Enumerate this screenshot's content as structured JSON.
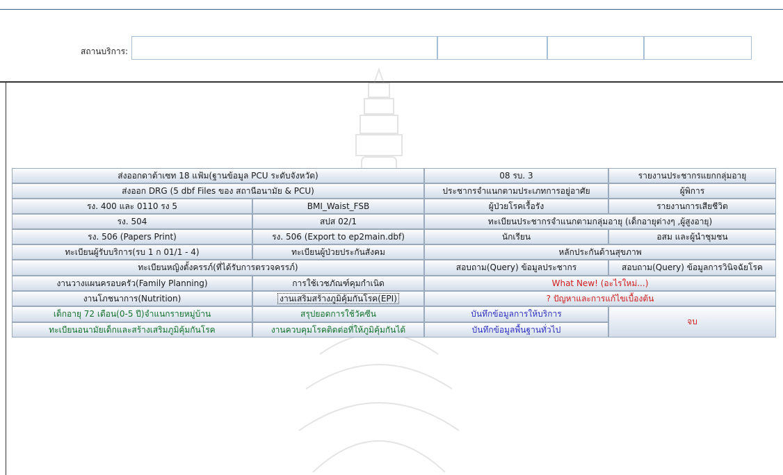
{
  "service": {
    "label": "สถานบริการ:",
    "fields": [
      "",
      "",
      "",
      ""
    ]
  },
  "buttons": [
    {
      "label": "ส่งออกดาต้าเซท 18 แฟ้ม(ฐานข้อมูล PCU ระดับจังหวัด)",
      "name": "export-18-files-button"
    },
    {
      "label": "08 รบ. 3",
      "name": "report-08-rb3-button"
    },
    {
      "label": "รายงานประชากรแยกกลุ่มอายุ",
      "name": "population-by-age-report-button"
    },
    {
      "label": "ส่งออก DRG (5 dbf Files ของ สถานีอนามัย & PCU)",
      "name": "export-drg-button"
    },
    {
      "label": "ประชากรจำแนกตามประเภทการอยู่อาศัย",
      "name": "population-by-residence-button"
    },
    {
      "label": "ผู้พิการ",
      "name": "disabled-persons-button"
    },
    {
      "label": "รง. 400 และ 0110 รง 5",
      "name": "report-400-0110-button"
    },
    {
      "label": "BMI_Waist_FSB",
      "name": "bmi-waist-fsb-button"
    },
    {
      "label": "ผู้ป่วยโรคเรื้อรัง",
      "name": "chronic-patients-button"
    },
    {
      "label": "รายงานการเสียชีวิต",
      "name": "death-report-button"
    },
    {
      "label": "รง. 504",
      "name": "report-504-button"
    },
    {
      "label": "สปส 02/1",
      "name": "sps-02-1-button"
    },
    {
      "label": "ทะเบียนประชากรจำแนกตามกลุ่มอายุ (เด็กอายุต่างๆ ,ผู้สูงอายุ)",
      "name": "population-registry-by-age-button"
    },
    {
      "label": "รง. 506 (Papers Print)",
      "name": "report-506-print-button"
    },
    {
      "label": "รง. 506 (Export to ep2main.dbf)",
      "name": "report-506-export-button"
    },
    {
      "label": "นักเรียน",
      "name": "students-button"
    },
    {
      "label": "อสม และผู้นำชุมชน",
      "name": "volunteers-leaders-button"
    },
    {
      "label": "ทะเบียนผู้รับบริการ(รบ 1 ก 01/1 - 4)",
      "name": "service-recipients-registry-button"
    },
    {
      "label": "ทะเบียนผู้ป่วยประกันสังคม",
      "name": "social-security-patients-button"
    },
    {
      "label": "หลักประกันด้านสุขภาพ",
      "name": "health-insurance-button"
    },
    {
      "label": "ทะเบียนหญิงตั้งครรภ์(ที่ได้รับการตรวจครรภ์)",
      "name": "pregnant-women-registry-button"
    },
    {
      "label": "สอบถาม(Query) ข้อมูลประชากร",
      "name": "query-population-button"
    },
    {
      "label": "สอบถาม(Query) ข้อมูลการวินิจฉัยโรค",
      "name": "query-diagnosis-button"
    },
    {
      "label": "งานวางแผนครอบครัว(Family Planning)",
      "name": "family-planning-button"
    },
    {
      "label": "การใช้เวชภัณฑ์คุมกำเนิด",
      "name": "contraceptive-supplies-button"
    },
    {
      "label": "What New! (อะไรใหม่...)",
      "name": "whats-new-button"
    },
    {
      "label": "งานโภชนาการ(Nutrition)",
      "name": "nutrition-button"
    },
    {
      "label": "งานเสริมสร้างภูมิคุ้มกันโรค(EPI)",
      "name": "epi-immunization-button"
    },
    {
      "label": "? ปัญหาและการแก้ไขเบื้องต้น",
      "name": "troubleshooting-button"
    },
    {
      "label": "เด็กอายุ 72 เดือน(0-5 ปี)จำแนกรายหมู่บ้าน",
      "name": "children-72-months-button"
    },
    {
      "label": "สรุปยอดการใช้วัคซีน",
      "name": "vaccine-usage-summary-button"
    },
    {
      "label": "บันทึกข้อมูลการให้บริการ",
      "name": "record-service-data-button"
    },
    {
      "label": "จบ",
      "name": "exit-button"
    },
    {
      "label": "ทะเบียนอนามัยเด็กและสร้างเสริมภูมิคุ้มกันโรค",
      "name": "child-health-immunization-registry-button"
    },
    {
      "label": "งานควบคุมโรคติดต่อที่ให้ภูมิคุ้มกันได้",
      "name": "vaccine-preventable-disease-control-button"
    },
    {
      "label": "บันทึกข้อมูลพื้นฐานทั่วไป",
      "name": "record-basic-data-button"
    }
  ]
}
